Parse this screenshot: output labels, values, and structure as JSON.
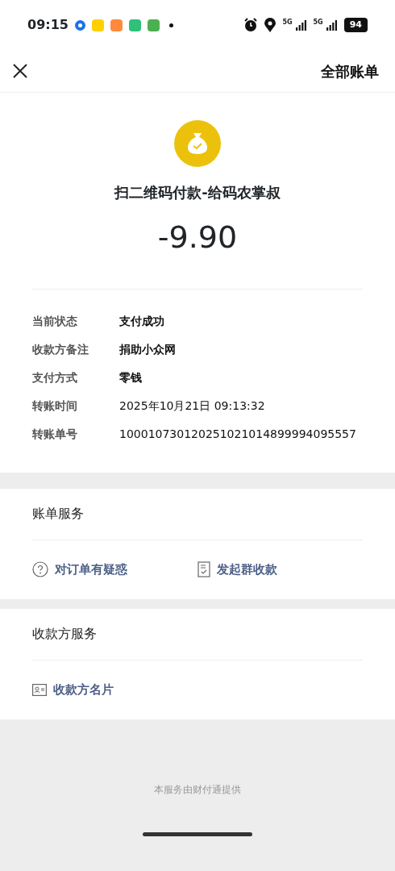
{
  "status_bar": {
    "time": "09:15",
    "network": [
      "5G",
      "5G"
    ],
    "battery": "94"
  },
  "header": {
    "title": "全部账单"
  },
  "summary": {
    "title": "扫二维码付款-给码农掌叔",
    "amount": "-9.90"
  },
  "details": [
    {
      "label": "当前状态",
      "value": "支付成功",
      "bold": true
    },
    {
      "label": "收款方备注",
      "value": "捐助小众网",
      "bold": true
    },
    {
      "label": "支付方式",
      "value": "零钱",
      "bold": true
    },
    {
      "label": "转账时间",
      "value": "2025年10月21日 09:13:32",
      "bold": false
    },
    {
      "label": "转账单号",
      "value": "100010730120251021014899994095557",
      "bold": false
    }
  ],
  "sections": [
    {
      "title": "账单服务",
      "actions": [
        {
          "kind": "question",
          "label": "对订单有疑惑"
        },
        {
          "kind": "checklist",
          "label": "发起群收款"
        }
      ]
    },
    {
      "title": "收款方服务",
      "actions": [
        {
          "kind": "card",
          "label": "收款方名片"
        }
      ]
    }
  ],
  "footer": "本服务由财付通提供"
}
